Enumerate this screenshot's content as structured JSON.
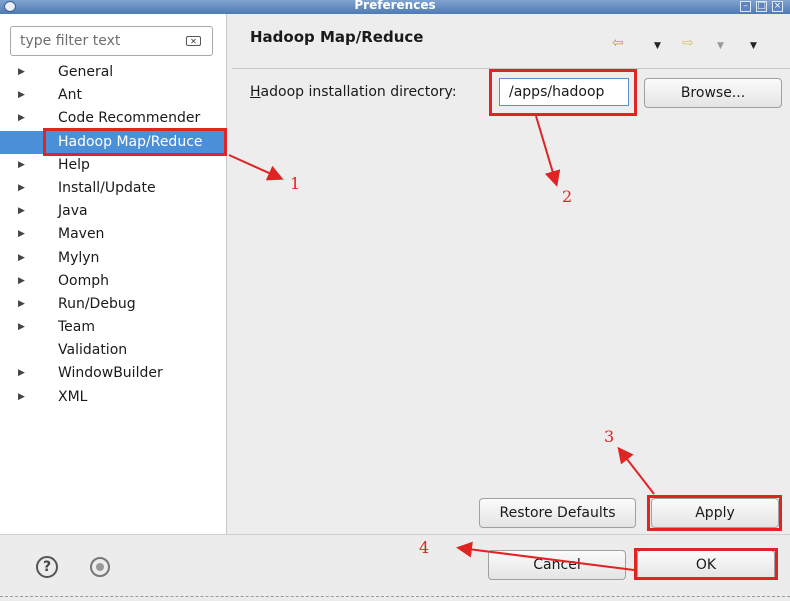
{
  "window": {
    "title": "Preferences"
  },
  "filter": {
    "placeholder": "type filter text"
  },
  "tree": {
    "items": [
      {
        "label": "General",
        "expandable": true
      },
      {
        "label": "Ant",
        "expandable": true
      },
      {
        "label": "Code Recommender",
        "expandable": true
      },
      {
        "label": "Hadoop Map/Reduce",
        "expandable": false,
        "selected": true
      },
      {
        "label": "Help",
        "expandable": true
      },
      {
        "label": "Install/Update",
        "expandable": true
      },
      {
        "label": "Java",
        "expandable": true
      },
      {
        "label": "Maven",
        "expandable": true
      },
      {
        "label": "Mylyn",
        "expandable": true
      },
      {
        "label": "Oomph",
        "expandable": true
      },
      {
        "label": "Run/Debug",
        "expandable": true
      },
      {
        "label": "Team",
        "expandable": true
      },
      {
        "label": "Validation",
        "expandable": false
      },
      {
        "label": "WindowBuilder",
        "expandable": true
      },
      {
        "label": "XML",
        "expandable": true
      }
    ]
  },
  "page": {
    "title": "Hadoop Map/Reduce",
    "install_dir_label": "Hadoop installation directory:",
    "install_dir_value": "/apps/hadoop",
    "browse_label": "Browse...",
    "restore_defaults_label": "Restore Defaults",
    "apply_label": "Apply"
  },
  "footer": {
    "cancel_label": "Cancel",
    "ok_label": "OK"
  },
  "annotations": {
    "step1": "1",
    "step2": "2",
    "step3": "3",
    "step4": "4"
  },
  "icons": {
    "back": "back-arrow-icon",
    "forward": "forward-arrow-icon",
    "menu": "view-menu-icon",
    "help": "help-icon",
    "record": "record-icon",
    "clear": "clear-filter-icon"
  },
  "colors": {
    "selection": "#4a90d9",
    "annotation": "#e02424",
    "titlebar": "#5a82bb"
  }
}
